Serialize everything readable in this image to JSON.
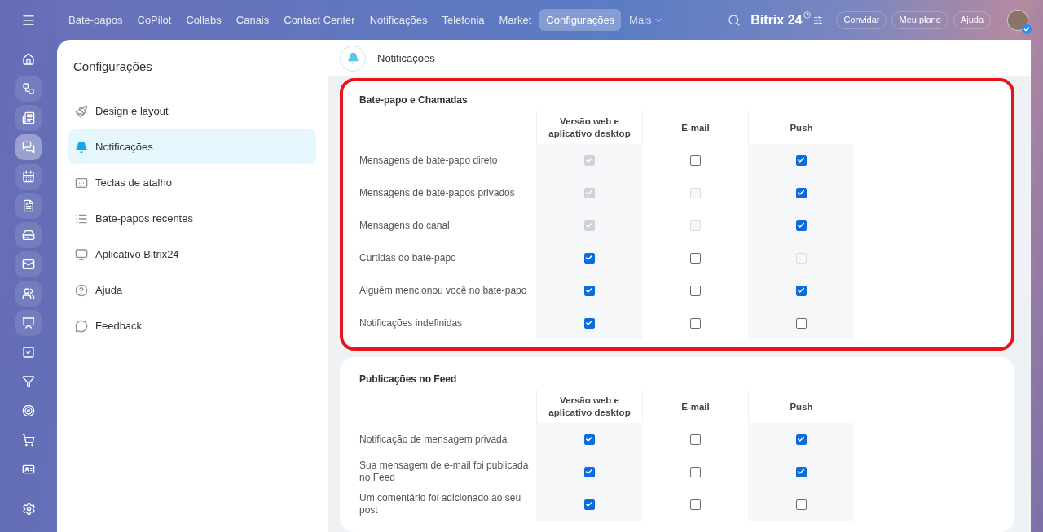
{
  "top_nav": {
    "items": [
      {
        "label": "Bate-papos",
        "selected": false
      },
      {
        "label": "CoPilot",
        "selected": false
      },
      {
        "label": "Collabs",
        "selected": false
      },
      {
        "label": "Canais",
        "selected": false
      },
      {
        "label": "Contact Center",
        "selected": false
      },
      {
        "label": "Notificações",
        "selected": false
      },
      {
        "label": "Telefonia",
        "selected": false
      },
      {
        "label": "Market",
        "selected": false
      },
      {
        "label": "Configurações",
        "selected": true
      }
    ],
    "more": "Mais",
    "logo": "Bitrix 24",
    "buttons": [
      "Convidar",
      "Meu plano",
      "Ajuda"
    ]
  },
  "rail": [
    {
      "selected": false
    },
    {
      "selected": false
    },
    {
      "selected": false
    },
    {
      "selected": true
    },
    {
      "selected": false
    },
    {
      "selected": false
    },
    {
      "selected": false
    },
    {
      "selected": false
    },
    {
      "selected": false
    },
    {
      "selected": false
    },
    {
      "selected": false
    },
    {
      "selected": false
    },
    {
      "selected": false
    },
    {
      "selected": false
    },
    {
      "selected": false
    }
  ],
  "sidebar": {
    "title": "Configurações",
    "items": [
      {
        "label": "Design e layout",
        "selected": false
      },
      {
        "label": "Notificações",
        "selected": true
      },
      {
        "label": "Teclas de atalho",
        "selected": false
      },
      {
        "label": "Bate-papos recentes",
        "selected": false
      },
      {
        "label": "Aplicativo Bitrix24",
        "selected": false
      },
      {
        "label": "Ajuda",
        "selected": false
      },
      {
        "label": "Feedback",
        "selected": false
      }
    ]
  },
  "header": {
    "title": "Notificações"
  },
  "sections": [
    {
      "title": "Bate-papo e Chamadas",
      "highlighted": true,
      "columns": [
        "Versão web e aplicativo desktop",
        "E-mail",
        "Push"
      ],
      "rows": [
        {
          "label": "Mensagens de bate-papo direto",
          "cells": [
            {
              "checked": true,
              "disabled": true
            },
            {
              "checked": false,
              "disabled": false
            },
            {
              "checked": true,
              "disabled": false
            }
          ]
        },
        {
          "label": "Mensagens de bate-papos privados",
          "cells": [
            {
              "checked": true,
              "disabled": true
            },
            {
              "checked": false,
              "disabled": true
            },
            {
              "checked": true,
              "disabled": false
            }
          ]
        },
        {
          "label": "Mensagens do canal",
          "cells": [
            {
              "checked": true,
              "disabled": true
            },
            {
              "checked": false,
              "disabled": true
            },
            {
              "checked": true,
              "disabled": false
            }
          ]
        },
        {
          "label": "Curtidas do bate-papo",
          "cells": [
            {
              "checked": true,
              "disabled": false
            },
            {
              "checked": false,
              "disabled": false
            },
            {
              "checked": false,
              "disabled": true
            }
          ]
        },
        {
          "label": "Alguém mencionou você no bate-papo",
          "cells": [
            {
              "checked": true,
              "disabled": false
            },
            {
              "checked": false,
              "disabled": false
            },
            {
              "checked": true,
              "disabled": false
            }
          ]
        },
        {
          "label": "Notificações indefinidas",
          "cells": [
            {
              "checked": true,
              "disabled": false
            },
            {
              "checked": false,
              "disabled": false
            },
            {
              "checked": false,
              "disabled": false
            }
          ]
        }
      ]
    },
    {
      "title": "Publicações no Feed",
      "highlighted": false,
      "columns": [
        "Versão web e aplicativo desktop",
        "E-mail",
        "Push"
      ],
      "rows": [
        {
          "label": "Notificação de mensagem privada",
          "cells": [
            {
              "checked": true,
              "disabled": false
            },
            {
              "checked": false,
              "disabled": false
            },
            {
              "checked": true,
              "disabled": false
            }
          ]
        },
        {
          "label": "Sua mensagem de e-mail foi publicada no Feed",
          "cells": [
            {
              "checked": true,
              "disabled": false
            },
            {
              "checked": false,
              "disabled": false
            },
            {
              "checked": true,
              "disabled": false
            }
          ]
        },
        {
          "label": "Um comentário foi adicionado ao seu post",
          "cells": [
            {
              "checked": true,
              "disabled": false
            },
            {
              "checked": false,
              "disabled": false
            },
            {
              "checked": false,
              "disabled": false
            }
          ]
        }
      ]
    }
  ]
}
